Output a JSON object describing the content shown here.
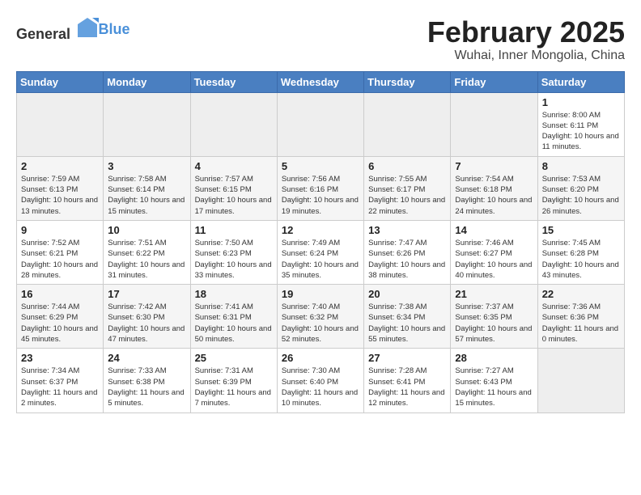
{
  "header": {
    "logo_general": "General",
    "logo_blue": "Blue",
    "title": "February 2025",
    "subtitle": "Wuhai, Inner Mongolia, China"
  },
  "calendar": {
    "days_of_week": [
      "Sunday",
      "Monday",
      "Tuesday",
      "Wednesday",
      "Thursday",
      "Friday",
      "Saturday"
    ],
    "weeks": [
      [
        {
          "day": "",
          "info": ""
        },
        {
          "day": "",
          "info": ""
        },
        {
          "day": "",
          "info": ""
        },
        {
          "day": "",
          "info": ""
        },
        {
          "day": "",
          "info": ""
        },
        {
          "day": "",
          "info": ""
        },
        {
          "day": "1",
          "info": "Sunrise: 8:00 AM\nSunset: 6:11 PM\nDaylight: 10 hours and 11 minutes."
        }
      ],
      [
        {
          "day": "2",
          "info": "Sunrise: 7:59 AM\nSunset: 6:13 PM\nDaylight: 10 hours and 13 minutes."
        },
        {
          "day": "3",
          "info": "Sunrise: 7:58 AM\nSunset: 6:14 PM\nDaylight: 10 hours and 15 minutes."
        },
        {
          "day": "4",
          "info": "Sunrise: 7:57 AM\nSunset: 6:15 PM\nDaylight: 10 hours and 17 minutes."
        },
        {
          "day": "5",
          "info": "Sunrise: 7:56 AM\nSunset: 6:16 PM\nDaylight: 10 hours and 19 minutes."
        },
        {
          "day": "6",
          "info": "Sunrise: 7:55 AM\nSunset: 6:17 PM\nDaylight: 10 hours and 22 minutes."
        },
        {
          "day": "7",
          "info": "Sunrise: 7:54 AM\nSunset: 6:18 PM\nDaylight: 10 hours and 24 minutes."
        },
        {
          "day": "8",
          "info": "Sunrise: 7:53 AM\nSunset: 6:20 PM\nDaylight: 10 hours and 26 minutes."
        }
      ],
      [
        {
          "day": "9",
          "info": "Sunrise: 7:52 AM\nSunset: 6:21 PM\nDaylight: 10 hours and 28 minutes."
        },
        {
          "day": "10",
          "info": "Sunrise: 7:51 AM\nSunset: 6:22 PM\nDaylight: 10 hours and 31 minutes."
        },
        {
          "day": "11",
          "info": "Sunrise: 7:50 AM\nSunset: 6:23 PM\nDaylight: 10 hours and 33 minutes."
        },
        {
          "day": "12",
          "info": "Sunrise: 7:49 AM\nSunset: 6:24 PM\nDaylight: 10 hours and 35 minutes."
        },
        {
          "day": "13",
          "info": "Sunrise: 7:47 AM\nSunset: 6:26 PM\nDaylight: 10 hours and 38 minutes."
        },
        {
          "day": "14",
          "info": "Sunrise: 7:46 AM\nSunset: 6:27 PM\nDaylight: 10 hours and 40 minutes."
        },
        {
          "day": "15",
          "info": "Sunrise: 7:45 AM\nSunset: 6:28 PM\nDaylight: 10 hours and 43 minutes."
        }
      ],
      [
        {
          "day": "16",
          "info": "Sunrise: 7:44 AM\nSunset: 6:29 PM\nDaylight: 10 hours and 45 minutes."
        },
        {
          "day": "17",
          "info": "Sunrise: 7:42 AM\nSunset: 6:30 PM\nDaylight: 10 hours and 47 minutes."
        },
        {
          "day": "18",
          "info": "Sunrise: 7:41 AM\nSunset: 6:31 PM\nDaylight: 10 hours and 50 minutes."
        },
        {
          "day": "19",
          "info": "Sunrise: 7:40 AM\nSunset: 6:32 PM\nDaylight: 10 hours and 52 minutes."
        },
        {
          "day": "20",
          "info": "Sunrise: 7:38 AM\nSunset: 6:34 PM\nDaylight: 10 hours and 55 minutes."
        },
        {
          "day": "21",
          "info": "Sunrise: 7:37 AM\nSunset: 6:35 PM\nDaylight: 10 hours and 57 minutes."
        },
        {
          "day": "22",
          "info": "Sunrise: 7:36 AM\nSunset: 6:36 PM\nDaylight: 11 hours and 0 minutes."
        }
      ],
      [
        {
          "day": "23",
          "info": "Sunrise: 7:34 AM\nSunset: 6:37 PM\nDaylight: 11 hours and 2 minutes."
        },
        {
          "day": "24",
          "info": "Sunrise: 7:33 AM\nSunset: 6:38 PM\nDaylight: 11 hours and 5 minutes."
        },
        {
          "day": "25",
          "info": "Sunrise: 7:31 AM\nSunset: 6:39 PM\nDaylight: 11 hours and 7 minutes."
        },
        {
          "day": "26",
          "info": "Sunrise: 7:30 AM\nSunset: 6:40 PM\nDaylight: 11 hours and 10 minutes."
        },
        {
          "day": "27",
          "info": "Sunrise: 7:28 AM\nSunset: 6:41 PM\nDaylight: 11 hours and 12 minutes."
        },
        {
          "day": "28",
          "info": "Sunrise: 7:27 AM\nSunset: 6:43 PM\nDaylight: 11 hours and 15 minutes."
        },
        {
          "day": "",
          "info": ""
        }
      ]
    ]
  }
}
